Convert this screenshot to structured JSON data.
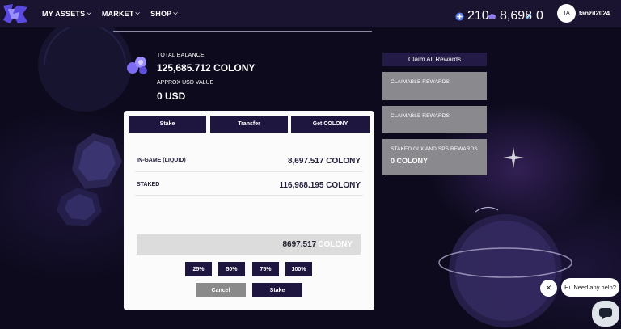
{
  "nav": {
    "menu": [
      {
        "label": "MY ASSETS"
      },
      {
        "label": "MARKET"
      },
      {
        "label": "SHOP"
      }
    ],
    "stats": [
      {
        "icon": "credits-icon",
        "value": "210"
      },
      {
        "icon": "vouchers-icon",
        "value": "8,698"
      },
      {
        "icon": "tickets-icon",
        "value": "0"
      }
    ],
    "avatar_initials": "TA",
    "username": "tanzil2024"
  },
  "balance": {
    "total_label": "TOTAL BALANCE",
    "total_value": "125,685.712 COLONY",
    "usd_label": "APPROX USD VALUE",
    "usd_value": "0 USD"
  },
  "card": {
    "tabs": [
      {
        "label": "Stake"
      },
      {
        "label": "Transfer"
      },
      {
        "label": "Get COLONY"
      }
    ],
    "rows": [
      {
        "label": "IN-GAME (LIQUID)",
        "value": "8,697.517 COLONY"
      },
      {
        "label": "STAKED",
        "value": "116,988.195 COLONY"
      }
    ],
    "amount_value": "8697.517",
    "amount_unit": "COLONY",
    "percent_buttons": [
      "25%",
      "50%",
      "75%",
      "100%"
    ],
    "cancel_label": "Cancel",
    "stake_label": "Stake"
  },
  "rewards": {
    "claim_all_label": "Claim All Rewards",
    "cards": [
      {
        "title": "CLAIMABLE REWARDS",
        "value": ""
      },
      {
        "title": "CLAIMABLE REWARDS",
        "value": ""
      },
      {
        "title": "STAKED GLX AND SPS REWARDS",
        "value": "0 COLONY"
      }
    ]
  },
  "chat": {
    "bubble_text": "Hi. Need any help?"
  },
  "colors": {
    "nav_bg": "#1a1430",
    "button_bg": "#1f1640",
    "card_bg": "#fbfbfb",
    "reward_card_bg": "#8a8a8e"
  }
}
